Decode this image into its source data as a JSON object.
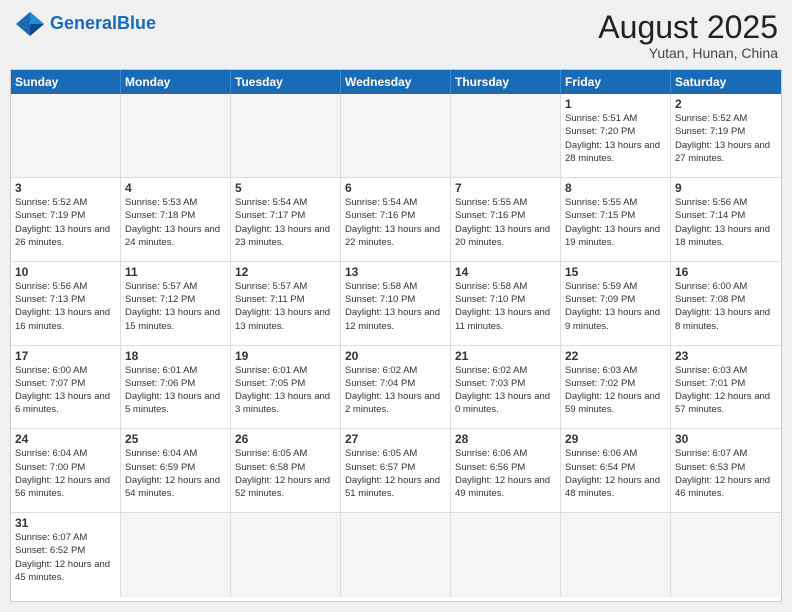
{
  "header": {
    "logo_general": "General",
    "logo_blue": "Blue",
    "month_title": "August 2025",
    "location": "Yutan, Hunan, China"
  },
  "weekdays": [
    "Sunday",
    "Monday",
    "Tuesday",
    "Wednesday",
    "Thursday",
    "Friday",
    "Saturday"
  ],
  "weeks": [
    [
      {
        "day": "",
        "empty": true
      },
      {
        "day": "",
        "empty": true
      },
      {
        "day": "",
        "empty": true
      },
      {
        "day": "",
        "empty": true
      },
      {
        "day": "",
        "empty": true
      },
      {
        "day": "1",
        "sunrise": "5:51 AM",
        "sunset": "7:20 PM",
        "daylight": "13 hours and 28 minutes."
      },
      {
        "day": "2",
        "sunrise": "5:52 AM",
        "sunset": "7:19 PM",
        "daylight": "13 hours and 27 minutes."
      }
    ],
    [
      {
        "day": "3",
        "sunrise": "5:52 AM",
        "sunset": "7:19 PM",
        "daylight": "13 hours and 26 minutes."
      },
      {
        "day": "4",
        "sunrise": "5:53 AM",
        "sunset": "7:18 PM",
        "daylight": "13 hours and 24 minutes."
      },
      {
        "day": "5",
        "sunrise": "5:54 AM",
        "sunset": "7:17 PM",
        "daylight": "13 hours and 23 minutes."
      },
      {
        "day": "6",
        "sunrise": "5:54 AM",
        "sunset": "7:16 PM",
        "daylight": "13 hours and 22 minutes."
      },
      {
        "day": "7",
        "sunrise": "5:55 AM",
        "sunset": "7:16 PM",
        "daylight": "13 hours and 20 minutes."
      },
      {
        "day": "8",
        "sunrise": "5:55 AM",
        "sunset": "7:15 PM",
        "daylight": "13 hours and 19 minutes."
      },
      {
        "day": "9",
        "sunrise": "5:56 AM",
        "sunset": "7:14 PM",
        "daylight": "13 hours and 18 minutes."
      }
    ],
    [
      {
        "day": "10",
        "sunrise": "5:56 AM",
        "sunset": "7:13 PM",
        "daylight": "13 hours and 16 minutes."
      },
      {
        "day": "11",
        "sunrise": "5:57 AM",
        "sunset": "7:12 PM",
        "daylight": "13 hours and 15 minutes."
      },
      {
        "day": "12",
        "sunrise": "5:57 AM",
        "sunset": "7:11 PM",
        "daylight": "13 hours and 13 minutes."
      },
      {
        "day": "13",
        "sunrise": "5:58 AM",
        "sunset": "7:10 PM",
        "daylight": "13 hours and 12 minutes."
      },
      {
        "day": "14",
        "sunrise": "5:58 AM",
        "sunset": "7:10 PM",
        "daylight": "13 hours and 11 minutes."
      },
      {
        "day": "15",
        "sunrise": "5:59 AM",
        "sunset": "7:09 PM",
        "daylight": "13 hours and 9 minutes."
      },
      {
        "day": "16",
        "sunrise": "6:00 AM",
        "sunset": "7:08 PM",
        "daylight": "13 hours and 8 minutes."
      }
    ],
    [
      {
        "day": "17",
        "sunrise": "6:00 AM",
        "sunset": "7:07 PM",
        "daylight": "13 hours and 6 minutes."
      },
      {
        "day": "18",
        "sunrise": "6:01 AM",
        "sunset": "7:06 PM",
        "daylight": "13 hours and 5 minutes."
      },
      {
        "day": "19",
        "sunrise": "6:01 AM",
        "sunset": "7:05 PM",
        "daylight": "13 hours and 3 minutes."
      },
      {
        "day": "20",
        "sunrise": "6:02 AM",
        "sunset": "7:04 PM",
        "daylight": "13 hours and 2 minutes."
      },
      {
        "day": "21",
        "sunrise": "6:02 AM",
        "sunset": "7:03 PM",
        "daylight": "13 hours and 0 minutes."
      },
      {
        "day": "22",
        "sunrise": "6:03 AM",
        "sunset": "7:02 PM",
        "daylight": "12 hours and 59 minutes."
      },
      {
        "day": "23",
        "sunrise": "6:03 AM",
        "sunset": "7:01 PM",
        "daylight": "12 hours and 57 minutes."
      }
    ],
    [
      {
        "day": "24",
        "sunrise": "6:04 AM",
        "sunset": "7:00 PM",
        "daylight": "12 hours and 56 minutes."
      },
      {
        "day": "25",
        "sunrise": "6:04 AM",
        "sunset": "6:59 PM",
        "daylight": "12 hours and 54 minutes."
      },
      {
        "day": "26",
        "sunrise": "6:05 AM",
        "sunset": "6:58 PM",
        "daylight": "12 hours and 52 minutes."
      },
      {
        "day": "27",
        "sunrise": "6:05 AM",
        "sunset": "6:57 PM",
        "daylight": "12 hours and 51 minutes."
      },
      {
        "day": "28",
        "sunrise": "6:06 AM",
        "sunset": "6:56 PM",
        "daylight": "12 hours and 49 minutes."
      },
      {
        "day": "29",
        "sunrise": "6:06 AM",
        "sunset": "6:54 PM",
        "daylight": "12 hours and 48 minutes."
      },
      {
        "day": "30",
        "sunrise": "6:07 AM",
        "sunset": "6:53 PM",
        "daylight": "12 hours and 46 minutes."
      }
    ],
    [
      {
        "day": "31",
        "sunrise": "6:07 AM",
        "sunset": "6:52 PM",
        "daylight": "12 hours and 45 minutes."
      },
      {
        "day": "",
        "empty": true
      },
      {
        "day": "",
        "empty": true
      },
      {
        "day": "",
        "empty": true
      },
      {
        "day": "",
        "empty": true
      },
      {
        "day": "",
        "empty": true
      },
      {
        "day": "",
        "empty": true
      }
    ]
  ]
}
